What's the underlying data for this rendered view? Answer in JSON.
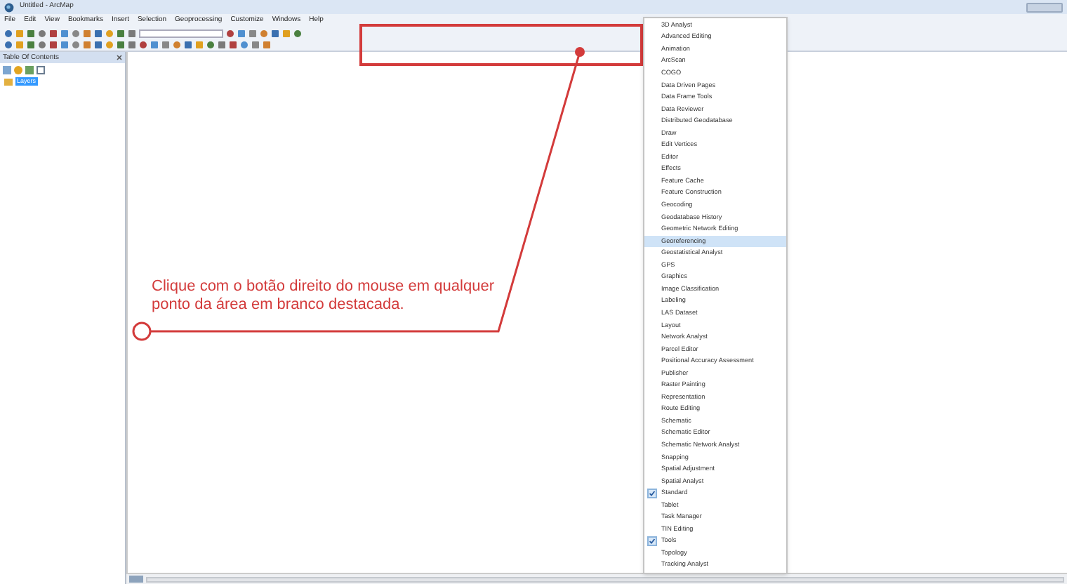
{
  "window": {
    "title": "Untitled - ArcMap"
  },
  "menu_bar": [
    "File",
    "Edit",
    "View",
    "Bookmarks",
    "Insert",
    "Selection",
    "Geoprocessing",
    "Customize",
    "Windows",
    "Help"
  ],
  "table_of_contents": {
    "title": "Table Of Contents",
    "layers": [
      {
        "label": "Layers",
        "selected": true
      }
    ]
  },
  "annotation": {
    "text": "Clique com o botão direito do mouse em qualquer ponto da área em branco destacada."
  },
  "context_menu": [
    {
      "label": "3D Analyst",
      "checked": false,
      "selected": false
    },
    {
      "label": "Advanced Editing",
      "checked": false,
      "selected": false
    },
    {
      "label": "Animation",
      "checked": false,
      "selected": false
    },
    {
      "label": "ArcScan",
      "checked": false,
      "selected": false
    },
    {
      "label": "COGO",
      "checked": false,
      "selected": false
    },
    {
      "label": "Data Driven Pages",
      "checked": false,
      "selected": false
    },
    {
      "label": "Data Frame Tools",
      "checked": false,
      "selected": false
    },
    {
      "label": "Data Reviewer",
      "checked": false,
      "selected": false
    },
    {
      "label": "Distributed Geodatabase",
      "checked": false,
      "selected": false
    },
    {
      "label": "Draw",
      "checked": false,
      "selected": false
    },
    {
      "label": "Edit Vertices",
      "checked": false,
      "selected": false
    },
    {
      "label": "Editor",
      "checked": false,
      "selected": false
    },
    {
      "label": "Effects",
      "checked": false,
      "selected": false
    },
    {
      "label": "Feature Cache",
      "checked": false,
      "selected": false
    },
    {
      "label": "Feature Construction",
      "checked": false,
      "selected": false
    },
    {
      "label": "Geocoding",
      "checked": false,
      "selected": false
    },
    {
      "label": "Geodatabase History",
      "checked": false,
      "selected": false
    },
    {
      "label": "Geometric Network Editing",
      "checked": false,
      "selected": false
    },
    {
      "label": "Georeferencing",
      "checked": false,
      "selected": true
    },
    {
      "label": "Geostatistical Analyst",
      "checked": false,
      "selected": false
    },
    {
      "label": "GPS",
      "checked": false,
      "selected": false
    },
    {
      "label": "Graphics",
      "checked": false,
      "selected": false
    },
    {
      "label": "Image Classification",
      "checked": false,
      "selected": false
    },
    {
      "label": "Labeling",
      "checked": false,
      "selected": false
    },
    {
      "label": "LAS Dataset",
      "checked": false,
      "selected": false
    },
    {
      "label": "Layout",
      "checked": false,
      "selected": false
    },
    {
      "label": "Network Analyst",
      "checked": false,
      "selected": false
    },
    {
      "label": "Parcel Editor",
      "checked": false,
      "selected": false
    },
    {
      "label": "Positional Accuracy Assessment",
      "checked": false,
      "selected": false
    },
    {
      "label": "Publisher",
      "checked": false,
      "selected": false
    },
    {
      "label": "Raster Painting",
      "checked": false,
      "selected": false
    },
    {
      "label": "Representation",
      "checked": false,
      "selected": false
    },
    {
      "label": "Route Editing",
      "checked": false,
      "selected": false
    },
    {
      "label": "Schematic",
      "checked": false,
      "selected": false
    },
    {
      "label": "Schematic Editor",
      "checked": false,
      "selected": false
    },
    {
      "label": "Schematic Network Analyst",
      "checked": false,
      "selected": false
    },
    {
      "label": "Snapping",
      "checked": false,
      "selected": false
    },
    {
      "label": "Spatial Adjustment",
      "checked": false,
      "selected": false
    },
    {
      "label": "Spatial Analyst",
      "checked": false,
      "selected": false
    },
    {
      "label": "Standard",
      "checked": true,
      "selected": false
    },
    {
      "label": "Tablet",
      "checked": false,
      "selected": false
    },
    {
      "label": "Task Manager",
      "checked": false,
      "selected": false
    },
    {
      "label": "TIN Editing",
      "checked": false,
      "selected": false
    },
    {
      "label": "Tools",
      "checked": true,
      "selected": false
    },
    {
      "label": "Topology",
      "checked": false,
      "selected": false
    },
    {
      "label": "Tracking Analyst",
      "checked": false,
      "selected": false
    }
  ]
}
